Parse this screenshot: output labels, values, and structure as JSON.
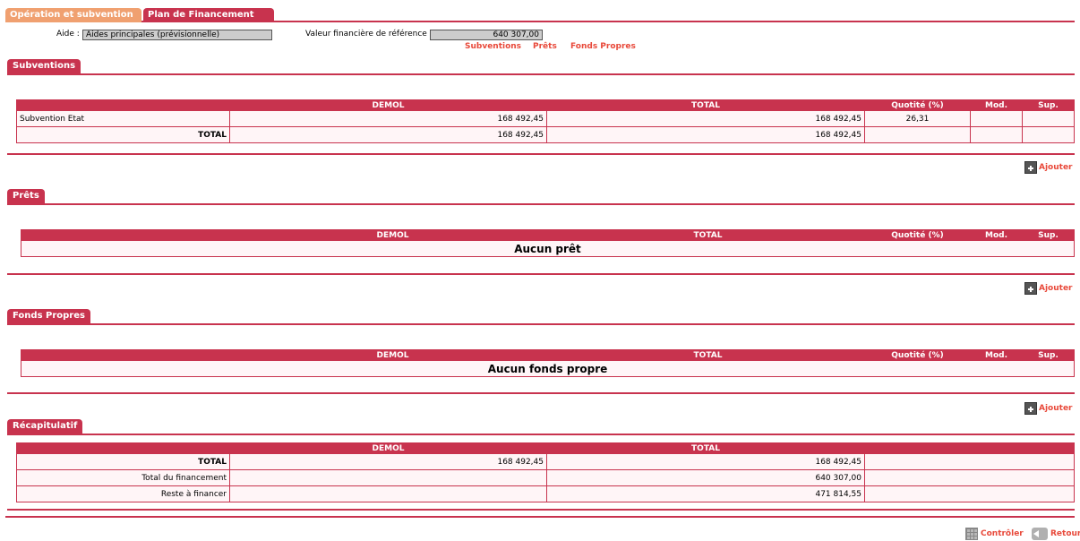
{
  "tabs": {
    "operation": "Opération et subvention",
    "plan": "Plan de Financement"
  },
  "header": {
    "aide_label": "Aide :",
    "aide_value": "Aides principales (prévisionnelle)",
    "valeur_label": "Valeur financière de référence :",
    "valeur_value": "640 307,00",
    "links": {
      "subventions": "Subventions",
      "prets": "Prêts",
      "fonds": "Fonds Propres"
    }
  },
  "columns": {
    "demol": "DEMOL",
    "total": "TOTAL",
    "quotite": "Quotité (%)",
    "mod": "Mod.",
    "sup": "Sup."
  },
  "subventions": {
    "title": "Subventions",
    "row": {
      "label": "Subvention Etat",
      "demol": "168 492,45",
      "total": "168 492,45",
      "quotite": "26,31"
    },
    "total_row": {
      "label": "TOTAL",
      "demol": "168 492,45",
      "total": "168 492,45"
    }
  },
  "prets": {
    "title": "Prêts",
    "empty": "Aucun prêt"
  },
  "fonds": {
    "title": "Fonds Propres",
    "empty": "Aucun fonds propre"
  },
  "recap": {
    "title": "Récapitulatif",
    "rows": [
      {
        "label": "TOTAL",
        "demol": "168 492,45",
        "total": "168 492,45"
      },
      {
        "label": "Total du financement",
        "demol": "",
        "total": "640 307,00"
      },
      {
        "label": "Reste à financer",
        "demol": "",
        "total": "471 814,55"
      }
    ]
  },
  "actions": {
    "ajouter": "Ajouter",
    "controler": "Contrôler",
    "retour": "Retour"
  },
  "colors": {
    "accent": "#c8334e",
    "tab_inactive": "#f0a070",
    "link": "#e8493a"
  }
}
